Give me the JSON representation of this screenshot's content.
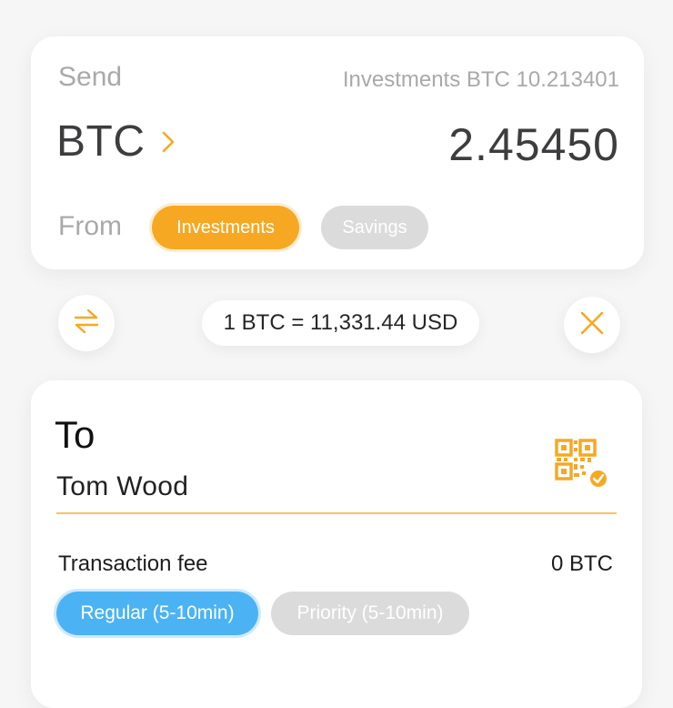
{
  "send": {
    "label": "Send",
    "balance_text": "Investments BTC 10.213401",
    "currency": "BTC",
    "amount": "2.45450",
    "from_label": "From",
    "accounts": [
      {
        "label": "Investments",
        "selected": true
      },
      {
        "label": "Savings",
        "selected": false
      }
    ]
  },
  "rate": {
    "text": "1 BTC = 11,331.44 USD"
  },
  "recipient": {
    "to_label": "To",
    "name": "Tom Wood"
  },
  "fee": {
    "label": "Transaction fee",
    "value": "0 BTC",
    "options": [
      {
        "label": "Regular (5-10min)",
        "selected": true
      },
      {
        "label": "Priority (5-10min)",
        "selected": false
      }
    ]
  },
  "icons": {
    "swap": "swap-arrows-icon",
    "close": "close-icon",
    "qr": "qr-code-icon",
    "chevron": "chevron-right-icon"
  },
  "colors": {
    "accent_orange": "#f6a823",
    "accent_blue": "#4bb3f4",
    "inactive_pill": "#dbdbdc"
  }
}
